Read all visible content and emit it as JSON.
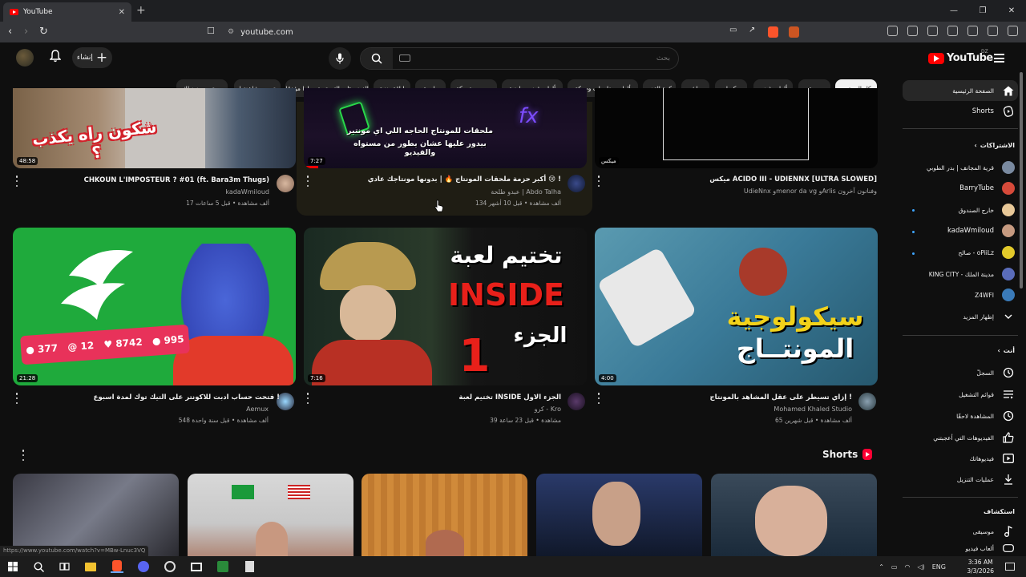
{
  "browser": {
    "tab_title": "YouTube",
    "url": "youtube.com",
    "status_url": "https://www.youtube.com/watch?v=MBw-Lnuc3VQ"
  },
  "header": {
    "create_label": "إنشاء",
    "search_placeholder": "بحث",
    "logo_text": "YouTube",
    "country_code": "DZ"
  },
  "chips": [
    "كل المحتوى",
    "موسيقى",
    "ألعاب فيديو",
    "ميكسات",
    "مباشر",
    "كرة القدم",
    "ألعاب مغامرات وحركة",
    "ألعاب فيديو رياضية",
    "رسوم متحركة",
    "طبيعة",
    "لياقة بدنية",
    "الفيديوهات التي تم تحميلها مؤخرًا",
    "تمت مشاهدتها",
    "محتوى جديد لك"
  ],
  "sidebar": {
    "home": "الصفحة الرئيسية",
    "shorts": "Shorts",
    "subscriptions_header": "الاشتراكات",
    "subscriptions": [
      "قرية المجانف | بدر الطوبي",
      "BarryTube",
      "خارج الصندوق",
      "kadaWmiloud",
      "صالح - oPiiLz",
      "KING CITY - مدينة الملك",
      "Z4WFI"
    ],
    "show_more": "إظهار المزيد",
    "you_header": "أنت",
    "you_items": [
      "السجلّ",
      "قوائم التشغيل",
      "المشاهدة لاحقًا",
      "الفيديوهات التي أعجبتني",
      "فيديوهاتك",
      "عمليات التنزيل"
    ],
    "explore_header": "استكشاف",
    "explore_items": [
      "موسيقى",
      "ألعاب فيديو"
    ]
  },
  "videos_row1": [
    {
      "title": "CHKOUN L'IMPOSTEUR ? #01 (ft. Bara3m Thugs)",
      "channel": "kadaWmiloud",
      "meta": "17 ألف مشاهدة • قبل 5 ساعات",
      "duration": "48:58",
      "thumb_text": "شكون راه يكذب ؟"
    },
    {
      "title": "أكبر حزمة ملحقات المونتاج 🔥 | بدونها مونتاجك عادي 😢 !",
      "channel": "عبدو طلحة | Abdo Talha",
      "meta": "134 ألف مشاهدة • قبل 10 أشهر",
      "duration": "7:27",
      "thumb_text_1": "ملحقات للمونتاج الحاجه اللي اي مونتير",
      "thumb_text_2": "بيدور عليها عشان يطور من مستواه والفيديو"
    },
    {
      "title": "ميكس ACIDO III - UDIENNX [ULTRA SLOWED]",
      "channel": "UdieNnx وmenor da vg وArlis وفنانون آخرون",
      "duration": "ميكس"
    }
  ],
  "videos_row2": [
    {
      "title": "فتحت حساب ادبت للاكونتر على التيك توك لمدة اسبوع !",
      "channel": "Aemux",
      "meta": "548 ألف مشاهدة • قبل سنة واحدة",
      "duration": "21:28",
      "stats": [
        "995",
        "8742",
        "12",
        "377"
      ]
    },
    {
      "title": "تختيم لعبة INSIDE الجزء الاول",
      "channel": "كرو - Kro",
      "meta": "39 مشاهدة • قبل 23 ساعة",
      "duration": "7:16",
      "thumb_line1": "تختيم لعبة",
      "thumb_line2": "INSIDE",
      "thumb_line3": "الجزء",
      "thumb_line4": "1"
    },
    {
      "title": "إزاي تسيطر على عقل المشاهد بالمونتاج !",
      "channel": "Mohamed Khaled Studio",
      "meta": "65 ألف مشاهدة • قبل شهرين",
      "duration": "4:00",
      "thumb_line1": "سيكولوجية",
      "thumb_line2": "المونتــاج"
    }
  ],
  "shorts": {
    "header": "Shorts"
  },
  "taskbar": {
    "lang": "ENG",
    "time": "3:36 AM",
    "date": "3/3/2026"
  }
}
